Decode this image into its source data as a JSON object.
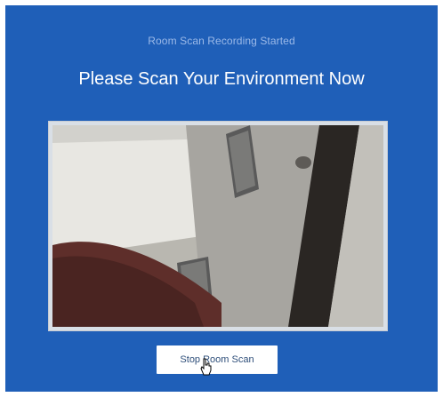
{
  "room_scan": {
    "status": "Room Scan Recording Started",
    "heading": "Please Scan Your Environment Now",
    "stop_button_label": "Stop Room Scan"
  },
  "icons": {
    "cursor": "hand-pointer-icon"
  },
  "colors": {
    "panel_background": "#1f5fb8",
    "status_text": "#9bb9e8",
    "heading_text": "#ffffff",
    "button_background": "#ffffff",
    "button_text": "#2f4f7a"
  }
}
